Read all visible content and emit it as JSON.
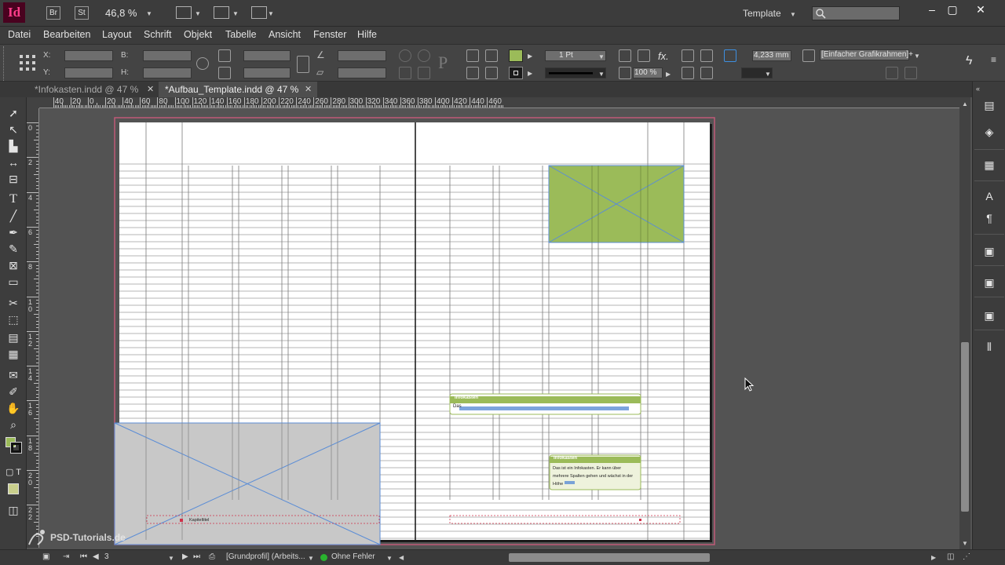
{
  "app": {
    "logo": "Id",
    "bridge_badge": "Br",
    "stock_badge": "St",
    "zoom_value": "46,8 %",
    "workspace": "Template",
    "search_placeholder": ""
  },
  "menu": [
    "Datei",
    "Bearbeiten",
    "Layout",
    "Schrift",
    "Objekt",
    "Tabelle",
    "Ansicht",
    "Fenster",
    "Hilfe"
  ],
  "control_panel": {
    "x_label": "X:",
    "y_label": "Y:",
    "w_label": "B:",
    "h_label": "H:",
    "stroke_weight": "1 Pt",
    "opacity": "100 %",
    "dimension": "4,233 mm",
    "object_style": "[Einfacher Grafikrahmen]+",
    "fill_color": "#9bbb59",
    "fx_label": "fx."
  },
  "tabs": [
    {
      "label": "*Infokasten.indd @ 47 %",
      "active": false
    },
    {
      "label": "*Aufbau_Template.indd @ 47 %",
      "active": true
    }
  ],
  "rulers": {
    "h_ticks": [
      "40",
      "20",
      "0",
      "20",
      "40",
      "60",
      "80",
      "100",
      "120",
      "140",
      "160",
      "180",
      "200",
      "220",
      "240",
      "260",
      "280",
      "300",
      "320",
      "340",
      "360",
      "380",
      "400",
      "420",
      "440",
      "460"
    ],
    "v_ticks": [
      "0",
      "2",
      "4",
      "6",
      "8",
      "1 0",
      "1 2",
      "1 4",
      "1 6",
      "1 8",
      "2 0",
      "2 2"
    ]
  },
  "document": {
    "infobox_1": {
      "title": "Infokasten",
      "body": "Das"
    },
    "infobox_2": {
      "title": "Infokasten",
      "body": "Das ist ein Infokasten. Er kann über mehrere Spalten gehen und wächst in der Höhe"
    },
    "chapter_label": "Kapiteltitel"
  },
  "status": {
    "page_number": "3",
    "profile": "[Grundprofil] (Arbeits...",
    "preflight": "Ohne Fehler"
  },
  "watermark": "PSD-Tutorials.de",
  "colors": {
    "accent_green": "#9bbb59",
    "frame_gray": "#c8c8c8",
    "bleed_red": "#c05a78",
    "frame_blue": "#5b8dd6"
  }
}
